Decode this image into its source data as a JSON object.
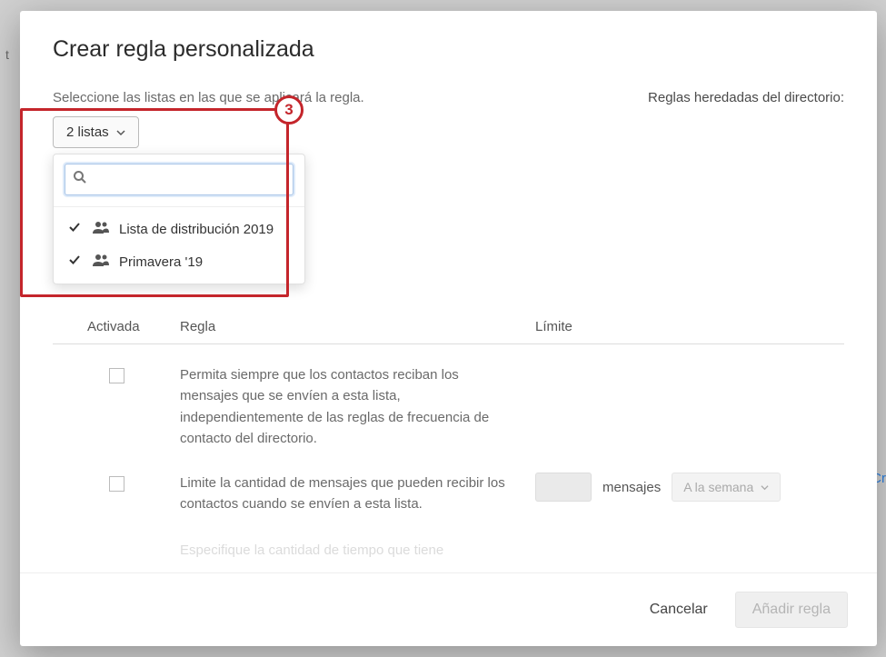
{
  "modal": {
    "title": "Crear regla personalizada",
    "instruction": "Seleccione las listas en las que se aplicará la regla.",
    "inherited_label": "Reglas heredadas del directorio:"
  },
  "dropdown": {
    "button_label": "2 listas",
    "search_placeholder": "",
    "items": [
      {
        "label": "Lista de distribución 2019",
        "selected": true
      },
      {
        "label": "Primavera '19",
        "selected": true
      }
    ]
  },
  "annotation": {
    "number": "3"
  },
  "table": {
    "headers": {
      "enabled": "Activada",
      "rule": "Regla",
      "limit": "Límite"
    },
    "rows": [
      {
        "text": "Permita siempre que los contactos reciban los mensajes que se envíen a esta lista, independientemente de las reglas de frecuencia de contacto del directorio.",
        "has_limit": false
      },
      {
        "text": "Limite la cantidad de mensajes que pueden recibir los contactos cuando se envíen a esta lista.",
        "has_limit": true,
        "limit_unit": "mensajes",
        "period_label": "A la semana"
      }
    ],
    "truncated": "Especifique la cantidad de tiempo que tiene"
  },
  "footer": {
    "cancel": "Cancelar",
    "submit": "Añadir regla"
  },
  "background": {
    "right_hint": "Cr",
    "left_hint": "t"
  }
}
